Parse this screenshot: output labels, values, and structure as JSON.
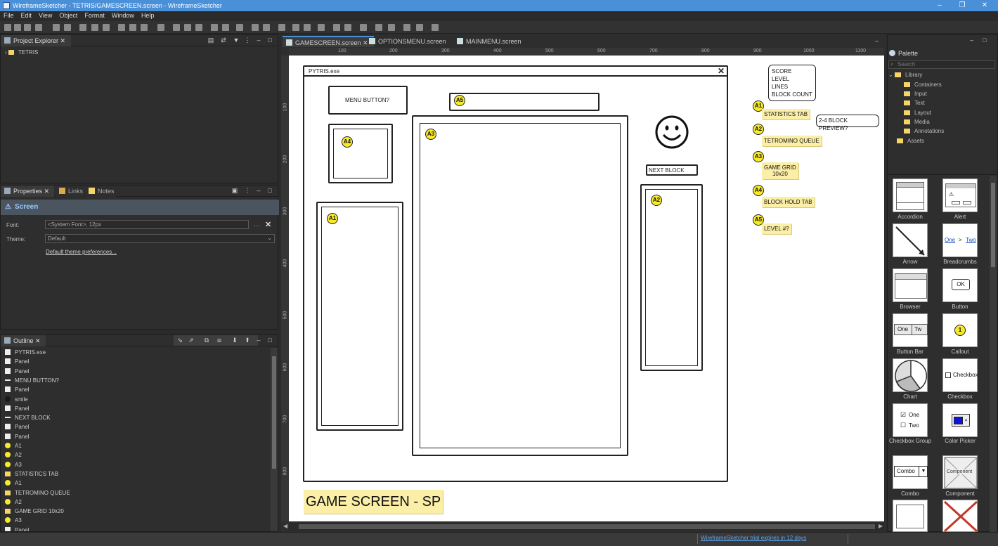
{
  "window": {
    "title": "WireframeSketcher - TETRIS/GAMESCREEN.screen - WireframeSketcher",
    "controls": [
      "–",
      "❐",
      "✕"
    ]
  },
  "menu": [
    "File",
    "Edit",
    "View",
    "Object",
    "Format",
    "Window",
    "Help"
  ],
  "project_explorer": {
    "tab": "Project Explorer",
    "root": "TETRIS"
  },
  "properties": {
    "tabs": [
      "Properties",
      "Links",
      "Notes"
    ],
    "section": "Screen",
    "font_label": "Font:",
    "font_value": "<System Font>, 12px",
    "theme_label": "Theme:",
    "theme_value": "Default",
    "theme_link": "Default theme preferences..."
  },
  "outline": {
    "tab": "Outline",
    "items": [
      {
        "icon": "window",
        "label": "PYTRIS.exe"
      },
      {
        "icon": "square",
        "label": "Panel"
      },
      {
        "icon": "square",
        "label": "Panel"
      },
      {
        "icon": "button",
        "label": "MENU BUTTON?"
      },
      {
        "icon": "square",
        "label": "Panel"
      },
      {
        "icon": "dark",
        "label": "smile"
      },
      {
        "icon": "square",
        "label": "Panel"
      },
      {
        "icon": "line",
        "label": "NEXT BLOCK"
      },
      {
        "icon": "square",
        "label": "Panel"
      },
      {
        "icon": "square",
        "label": "Panel"
      },
      {
        "icon": "callout",
        "label": "A1"
      },
      {
        "icon": "callout",
        "label": "A2"
      },
      {
        "icon": "callout",
        "label": "A3"
      },
      {
        "icon": "note",
        "label": "STATISTICS TAB"
      },
      {
        "icon": "callout",
        "label": "A1"
      },
      {
        "icon": "note",
        "label": "TETROMINO QUEUE"
      },
      {
        "icon": "callout",
        "label": "A2"
      },
      {
        "icon": "note",
        "label": "GAME GRID  10x20"
      },
      {
        "icon": "callout",
        "label": "A3"
      },
      {
        "icon": "square",
        "label": "Panel"
      }
    ]
  },
  "editor": {
    "tabs": [
      {
        "label": "GAMESCREEN.screen",
        "active": true
      },
      {
        "label": "OPTIONSMENU.screen",
        "active": false
      },
      {
        "label": "MAINMENU.screen",
        "active": false
      }
    ],
    "ruler_x": [
      "100",
      "200",
      "300",
      "400",
      "500",
      "600",
      "700",
      "800",
      "900",
      "1000",
      "1100"
    ],
    "ruler_y": [
      "100",
      "200",
      "300",
      "400",
      "500",
      "600",
      "700",
      "800"
    ]
  },
  "sketch": {
    "window_title": "PYTRIS.exe",
    "menu_button": "MENU BUTTON?",
    "next_block": "NEXT BLOCK",
    "callouts": [
      "A5",
      "A4",
      "A3",
      "A1",
      "A2"
    ],
    "bubble_stats": [
      "SCORE",
      "LEVEL",
      "LINES",
      "BLOCK COUNT"
    ],
    "bubble_preview": "2-4 BLOCK PREVIEW?",
    "notes": [
      {
        "callout": "A1",
        "text": "STATISTICS TAB"
      },
      {
        "callout": "A2",
        "text": "TETROMINO QUEUE"
      },
      {
        "callout": "A3",
        "text": "GAME GRID\n10x20"
      },
      {
        "callout": "A4",
        "text": "BLOCK HOLD TAB"
      },
      {
        "callout": "A5",
        "text": "LEVEL #?"
      }
    ],
    "footer_note": "GAME SCREEN - SP"
  },
  "palette": {
    "title": "Palette",
    "search_placeholder": "Search",
    "library": "Library",
    "folders": [
      "Containers",
      "Input",
      "Text",
      "Layout",
      "Media",
      "Annotations"
    ],
    "assets": "Assets",
    "widgets": [
      {
        "name": "Accordion"
      },
      {
        "name": "Alert"
      },
      {
        "name": "Arrow"
      },
      {
        "name": "Breadcrumbs"
      },
      {
        "name": "Browser"
      },
      {
        "name": "Button"
      },
      {
        "name": "Button Bar"
      },
      {
        "name": "Callout"
      },
      {
        "name": "Chart"
      },
      {
        "name": "Checkbox"
      },
      {
        "name": "Checkbox Group"
      },
      {
        "name": "Color Picker"
      },
      {
        "name": "Combo"
      },
      {
        "name": "Component"
      }
    ],
    "widget_texts": {
      "breadcrumb_one": "One",
      "breadcrumb_sep": ">",
      "breadcrumb_two": "Two",
      "button_ok": "OK",
      "callout_num": "1",
      "checkbox": "Checkbox",
      "cbgroup_one": "One",
      "cbgroup_two": "Two",
      "buttonbar_one": "One",
      "buttonbar_two": "Tw",
      "combo": "Combo",
      "component": "Component"
    }
  },
  "status": {
    "trial": "WireframeSketcher trial expires in 12 days"
  }
}
